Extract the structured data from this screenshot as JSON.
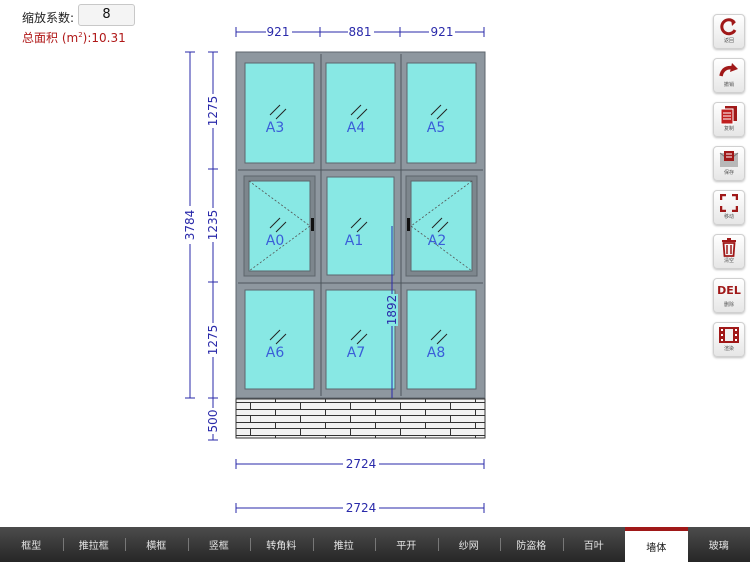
{
  "header": {
    "scale_label": "缩放系数:",
    "scale_value": "8",
    "area_label": "总面积 (m",
    "area_unit_sup": "2",
    "area_value": "):10.31"
  },
  "dimensions": {
    "top": [
      "921",
      "881",
      "921"
    ],
    "left_total": "3784",
    "left_rows": [
      "1275",
      "1235",
      "1275",
      "500"
    ],
    "mullion": "1892",
    "bottom_width_1": "2724",
    "bottom_width_2": "2724"
  },
  "panes": [
    {
      "label": "A3",
      "kind": "fixed"
    },
    {
      "label": "A4",
      "kind": "fixed"
    },
    {
      "label": "A5",
      "kind": "fixed"
    },
    {
      "label": "A0",
      "kind": "casement-left"
    },
    {
      "label": "A1",
      "kind": "fixed"
    },
    {
      "label": "A2",
      "kind": "casement-right"
    },
    {
      "label": "A6",
      "kind": "fixed"
    },
    {
      "label": "A7",
      "kind": "fixed"
    },
    {
      "label": "A8",
      "kind": "fixed"
    }
  ],
  "tools": [
    {
      "label": "返回",
      "icon": "undo-arrow-icon"
    },
    {
      "label": "撤销",
      "icon": "redo-arrow-icon"
    },
    {
      "label": "复制",
      "icon": "copy-icon"
    },
    {
      "label": "保存",
      "icon": "save-icon"
    },
    {
      "label": "移动",
      "icon": "move-icon"
    },
    {
      "label": "清空",
      "icon": "trash-icon"
    },
    {
      "label": "删除",
      "icon": "delete-icon",
      "text": "DEL"
    },
    {
      "label": "渲染",
      "icon": "render-film-icon"
    }
  ],
  "tabs": [
    "框型",
    "推拉框",
    "横框",
    "竖框",
    "转角料",
    "推拉",
    "平开",
    "纱网",
    "防盗格",
    "百叶",
    "墙体",
    "玻璃"
  ],
  "active_tab": "墙体",
  "colors": {
    "frame": "#8e979f",
    "glass": "#88e8e4",
    "dimension": "#2a2aaa",
    "pane_label": "#3a5ed8",
    "accent": "#a01818"
  }
}
